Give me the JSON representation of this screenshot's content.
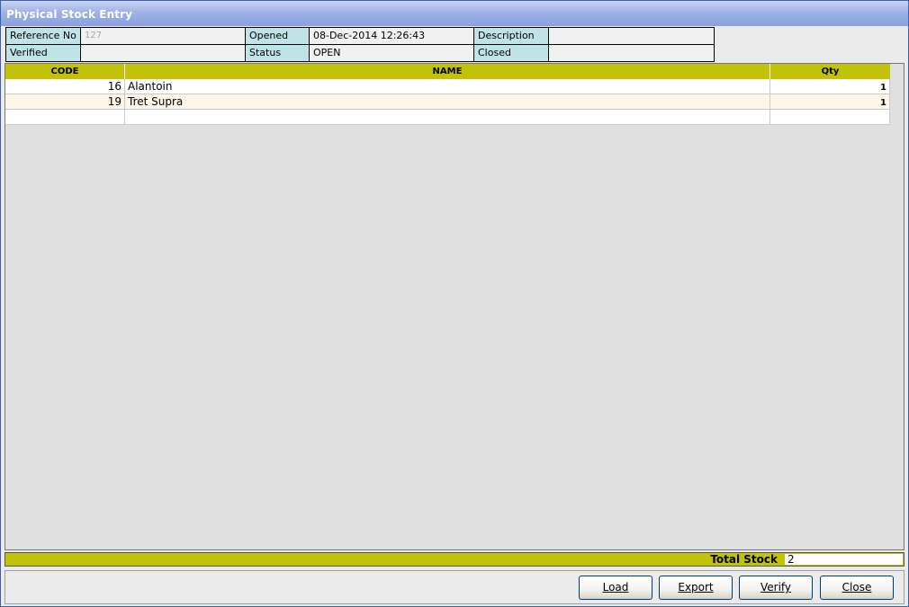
{
  "window": {
    "title": "Physical Stock Entry"
  },
  "header": {
    "reference_label": "Reference No",
    "reference_value": "127",
    "opened_label": "Opened",
    "opened_value": "08-Dec-2014 12:26:43",
    "description_label": "Description",
    "description_value": "",
    "verified_label": "Verified",
    "verified_value": "",
    "status_label": "Status",
    "status_value": "OPEN",
    "closed_label": "Closed",
    "closed_value": ""
  },
  "grid": {
    "columns": [
      "CODE",
      "NAME",
      "Qty"
    ],
    "rows": [
      {
        "code": "16",
        "name": "Alantoin",
        "qty": "1"
      },
      {
        "code": "19",
        "name": "Tret Supra",
        "qty": "1"
      },
      {
        "code": "",
        "name": "",
        "qty": ""
      }
    ]
  },
  "footer": {
    "total_label": "Total Stock",
    "total_value": "2"
  },
  "buttons": {
    "load": "Load",
    "export": "Export",
    "verify": "Verify",
    "close": "Close"
  },
  "colors": {
    "header_yellow": "#c2c20a",
    "label_cyan": "#bfe3e6",
    "row_alt": "#fdf6e8",
    "titlebar": "#9fb2e6"
  }
}
